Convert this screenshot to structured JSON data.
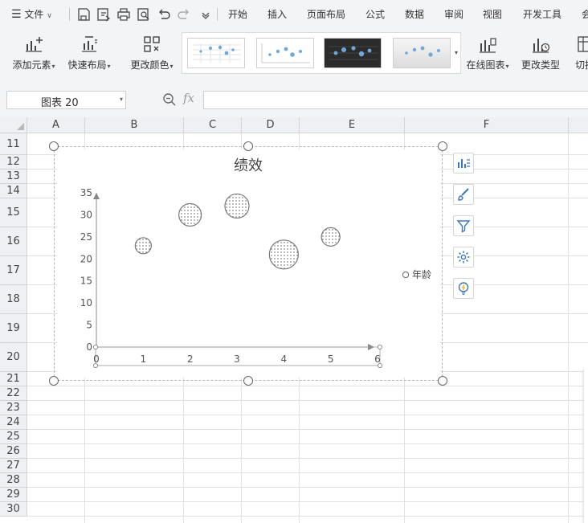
{
  "menubar": {
    "file_label": "文件",
    "tabs": [
      {
        "label": "开始"
      },
      {
        "label": "插入"
      },
      {
        "label": "页面布局"
      },
      {
        "label": "公式"
      },
      {
        "label": "数据"
      },
      {
        "label": "审阅"
      },
      {
        "label": "视图"
      },
      {
        "label": "开发工具"
      },
      {
        "label": "会"
      }
    ]
  },
  "ribbon": {
    "add_element": "添加元素",
    "quick_layout": "快速布局",
    "change_color": "更改颜色",
    "online_chart": "在线图表",
    "change_type": "更改类型",
    "switch": "切换"
  },
  "formula_bar": {
    "name_box": "图表 20",
    "fx": "fx",
    "formula": ""
  },
  "sheet": {
    "columns": [
      "A",
      "B",
      "C",
      "D",
      "E",
      "F"
    ],
    "rows": [
      "11",
      "12",
      "13",
      "14",
      "15",
      "16",
      "17",
      "18",
      "19",
      "20",
      "21",
      "22",
      "23",
      "24",
      "25",
      "26",
      "27",
      "28",
      "29",
      "30"
    ]
  },
  "chart_data": {
    "type": "bubble",
    "title": "绩效",
    "xlabel": "",
    "ylabel": "",
    "xlim": [
      0,
      6
    ],
    "ylim": [
      0,
      35
    ],
    "x_ticks": [
      "0",
      "1",
      "2",
      "3",
      "4",
      "5",
      "6"
    ],
    "y_ticks": [
      "0",
      "5",
      "10",
      "15",
      "20",
      "25",
      "30",
      "35"
    ],
    "grid": false,
    "legend_position": "right",
    "series": [
      {
        "name": "年龄",
        "points": [
          {
            "x": 1,
            "y": 23,
            "size": 1.0
          },
          {
            "x": 2,
            "y": 30,
            "size": 1.4
          },
          {
            "x": 3,
            "y": 32,
            "size": 1.5
          },
          {
            "x": 4,
            "y": 21,
            "size": 1.8
          },
          {
            "x": 5,
            "y": 25,
            "size": 1.15
          }
        ]
      }
    ],
    "colors": {
      "bubble_fill": "#ffffff",
      "bubble_stroke": "#7a7a7a",
      "axis": "#888888"
    }
  },
  "chart_tools": [
    "chart-elements-icon",
    "chart-style-icon",
    "chart-filter-icon",
    "chart-settings-icon",
    "chart-idea-icon"
  ]
}
